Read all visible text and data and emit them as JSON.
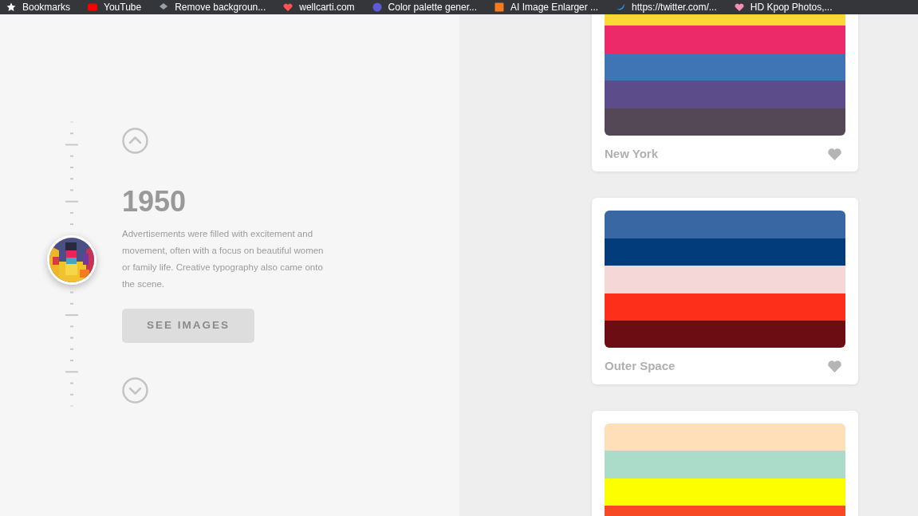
{
  "bookmarks": [
    {
      "label": "Bookmarks"
    },
    {
      "label": "YouTube"
    },
    {
      "label": "Remove backgroun..."
    },
    {
      "label": "wellcarti.com"
    },
    {
      "label": "Color palette gener..."
    },
    {
      "label": "AI Image Enlarger ..."
    },
    {
      "label": "https://twitter.com/..."
    },
    {
      "label": "HD Kpop Photos,..."
    }
  ],
  "timeline": {
    "year": "1950",
    "description": "Advertisements were filled with excitement and movement, often with a focus on beautiful women or family life. Creative typography also came onto the scene.",
    "button": "SEE IMAGES"
  },
  "palettes": [
    {
      "name": "New York",
      "stripes": [
        {
          "color": "#fdd835"
        },
        {
          "color": "#ec2a6a"
        },
        {
          "color": "#3f74b5"
        },
        {
          "color": "#5c4d8a"
        },
        {
          "color": "#544857"
        }
      ]
    },
    {
      "name": "Outer Space",
      "stripes": [
        {
          "color": "#3867a4"
        },
        {
          "color": "#033c7a"
        },
        {
          "color": "#f5d7d8"
        },
        {
          "color": "#fd2e1a"
        },
        {
          "color": "#6c0d14"
        }
      ]
    },
    {
      "stripes": [
        {
          "color": "#fedfb7"
        },
        {
          "color": "#abdbc9"
        },
        {
          "color": "#fdfe00"
        },
        {
          "color": "#f74a24"
        }
      ]
    }
  ]
}
